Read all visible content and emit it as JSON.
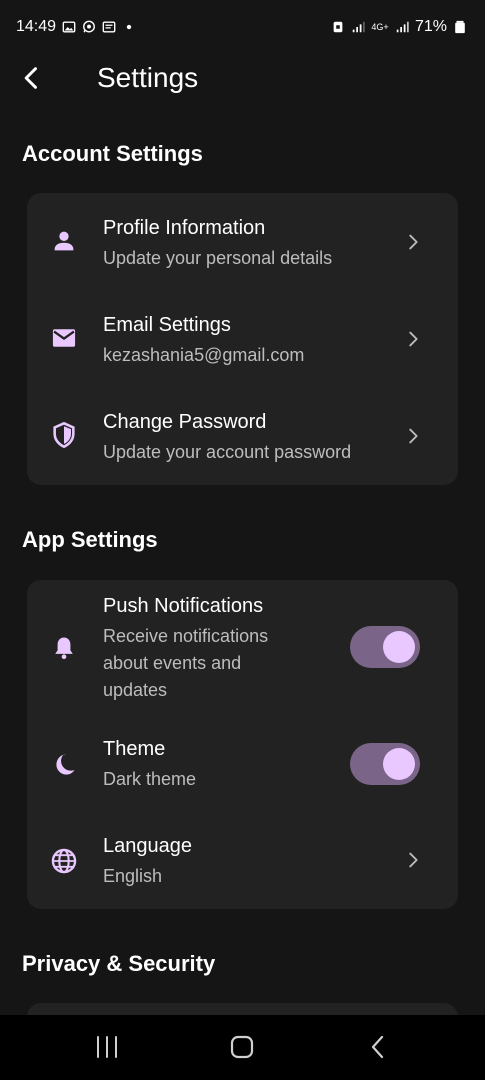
{
  "status_bar": {
    "time": "14:49",
    "network_type": "4G+",
    "battery": "71%",
    "icons": [
      "gallery-icon",
      "whatsapp-icon",
      "message-icon",
      "dot-icon",
      "alarm-icon",
      "signal-icon",
      "network-icon",
      "signal-icon",
      "battery-icon"
    ]
  },
  "header": {
    "title": "Settings",
    "back_icon": "back-arrow-icon"
  },
  "sections": {
    "account": {
      "title": "Account Settings",
      "items": [
        {
          "title": "Profile Information",
          "subtitle": "Update your personal details",
          "icon": "person-icon",
          "control": "chevron"
        },
        {
          "title": "Email Settings",
          "subtitle": "kezashania5@gmail.com",
          "icon": "mail-icon",
          "control": "chevron"
        },
        {
          "title": "Change Password",
          "subtitle": "Update your account password",
          "icon": "shield-icon",
          "control": "chevron"
        }
      ]
    },
    "app": {
      "title": "App Settings",
      "items": [
        {
          "title": "Push Notifications",
          "subtitle": "Receive notifications about events and updates",
          "icon": "bell-icon",
          "control": "toggle",
          "enabled": true
        },
        {
          "title": "Theme",
          "subtitle": "Dark theme",
          "icon": "moon-icon",
          "control": "toggle",
          "enabled": true
        },
        {
          "title": "Language",
          "subtitle": "English",
          "icon": "globe-icon",
          "control": "chevron"
        }
      ]
    },
    "privacy": {
      "title": "Privacy & Security"
    }
  },
  "nav": {
    "icons": [
      "recent-apps-icon",
      "home-icon",
      "back-icon"
    ]
  },
  "colors": {
    "background": "#151515",
    "card": "#222222",
    "accent": "#e8c8ff",
    "toggle_track": "#7a6588",
    "secondary_text": "#bdbdbd"
  }
}
